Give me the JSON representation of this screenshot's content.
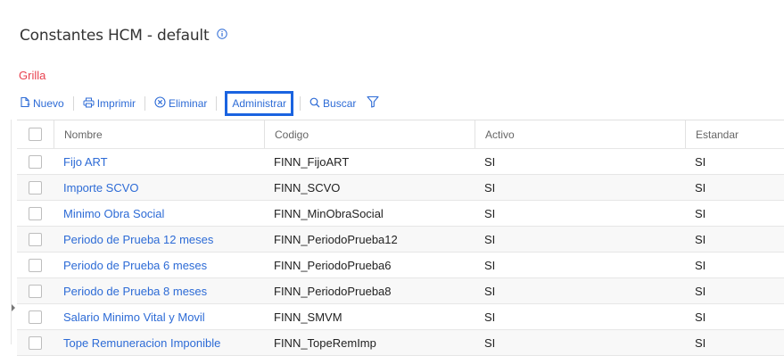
{
  "page": {
    "title": "Constantes HCM - default",
    "section_label": "Grilla"
  },
  "toolbar": {
    "nuevo": "Nuevo",
    "imprimir": "Imprimir",
    "eliminar": "Eliminar",
    "administrar": "Administrar",
    "buscar": "Buscar"
  },
  "colors": {
    "accent": "#2d6bd6",
    "section_label": "#e8424f",
    "active_border": "#1a63e0"
  },
  "grid": {
    "columns": [
      "Nombre",
      "Codigo",
      "Activo",
      "Estandar"
    ],
    "rows": [
      {
        "nombre": "Fijo ART",
        "codigo": "FINN_FijoART",
        "activo": "SI",
        "estandar": "SI"
      },
      {
        "nombre": "Importe SCVO",
        "codigo": "FINN_SCVO",
        "activo": "SI",
        "estandar": "SI"
      },
      {
        "nombre": "Minimo Obra Social",
        "codigo": "FINN_MinObraSocial",
        "activo": "SI",
        "estandar": "SI"
      },
      {
        "nombre": "Periodo de Prueba 12 meses",
        "codigo": "FINN_PeriodoPrueba12",
        "activo": "SI",
        "estandar": "SI"
      },
      {
        "nombre": "Periodo de Prueba 6 meses",
        "codigo": "FINN_PeriodoPrueba6",
        "activo": "SI",
        "estandar": "SI"
      },
      {
        "nombre": "Periodo de Prueba 8 meses",
        "codigo": "FINN_PeriodoPrueba8",
        "activo": "SI",
        "estandar": "SI"
      },
      {
        "nombre": "Salario Minimo Vital y Movil",
        "codigo": "FINN_SMVM",
        "activo": "SI",
        "estandar": "SI"
      },
      {
        "nombre": "Tope Remuneracion Imponible",
        "codigo": "FINN_TopeRemImp",
        "activo": "SI",
        "estandar": "SI"
      }
    ]
  }
}
